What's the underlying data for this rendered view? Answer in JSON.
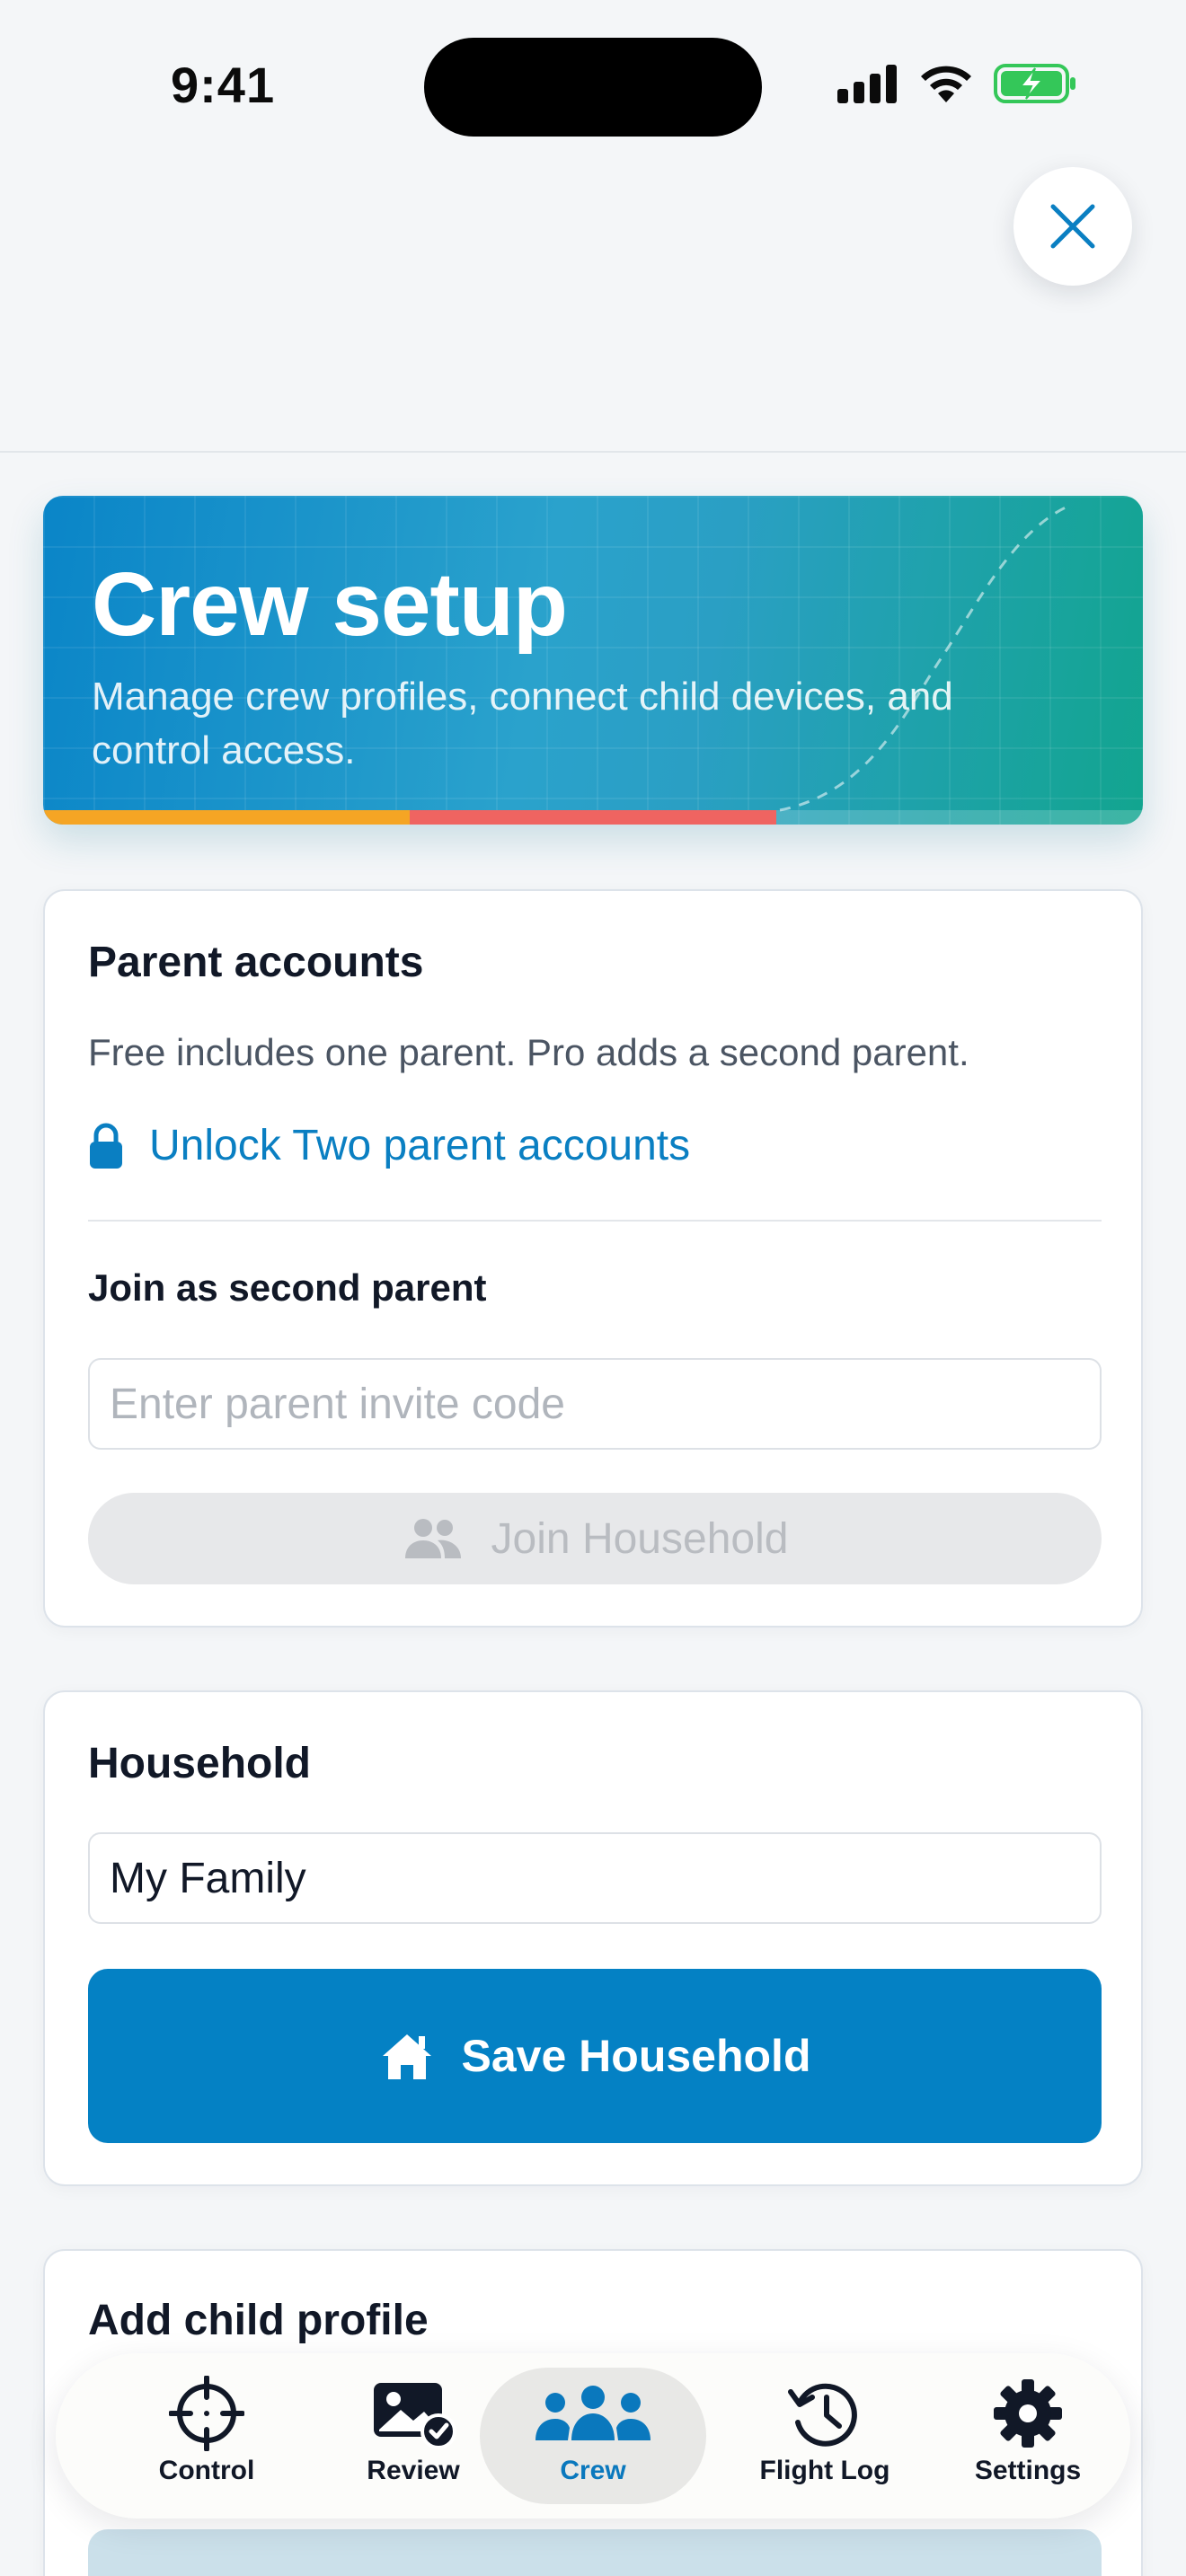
{
  "status_bar": {
    "time": "9:41"
  },
  "hero": {
    "title": "Crew setup",
    "subtitle": "Manage crew profiles, connect child devices, and control access."
  },
  "parent_accounts": {
    "title": "Parent accounts",
    "description": "Free includes one parent. Pro adds a second parent.",
    "unlock_label": "Unlock Two parent accounts",
    "join_label": "Join as second parent",
    "invite_placeholder": "Enter parent invite code",
    "join_button": "Join Household"
  },
  "household": {
    "title": "Household",
    "name_value": "My Family",
    "save_button": "Save Household"
  },
  "child_profile": {
    "title": "Add child profile"
  },
  "tabbar": {
    "tabs": [
      {
        "label": "Control",
        "icon": "crosshair-icon"
      },
      {
        "label": "Review",
        "icon": "photo-check-icon"
      },
      {
        "label": "Crew",
        "icon": "people-icon",
        "active": true
      },
      {
        "label": "Flight Log",
        "icon": "history-icon"
      },
      {
        "label": "Settings",
        "icon": "gear-icon"
      }
    ]
  },
  "colors": {
    "accent": "#0481C4",
    "hero_start": "#0A85C8",
    "hero_end": "#12A58F",
    "stripe_orange": "#F5A524",
    "stripe_red": "#EF6461",
    "battery_green": "#34C759"
  }
}
